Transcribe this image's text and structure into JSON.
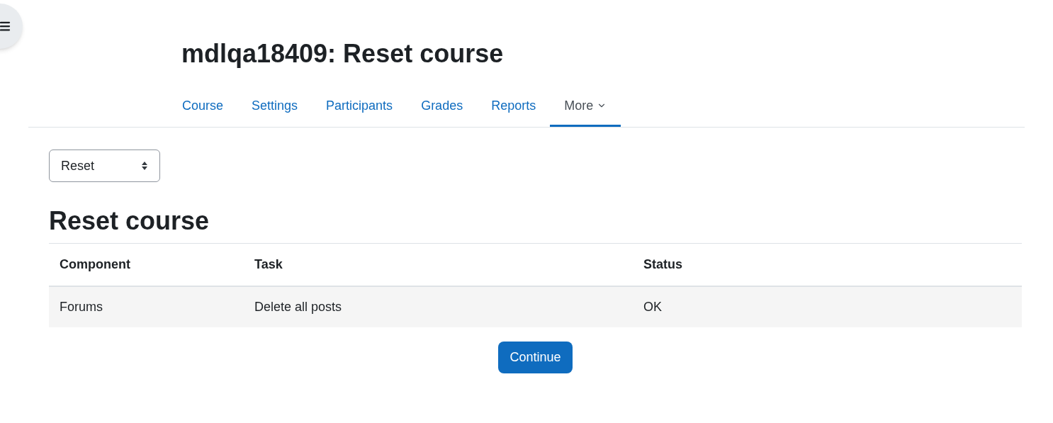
{
  "page_title": "mdlqa18409: Reset course",
  "tabs": [
    {
      "label": "Course",
      "selected": false,
      "kind": "link"
    },
    {
      "label": "Settings",
      "selected": false,
      "kind": "link"
    },
    {
      "label": "Participants",
      "selected": false,
      "kind": "link"
    },
    {
      "label": "Grades",
      "selected": false,
      "kind": "link"
    },
    {
      "label": "Reports",
      "selected": false,
      "kind": "link"
    },
    {
      "label": "More",
      "selected": true,
      "kind": "dropdown"
    }
  ],
  "select": {
    "value": "Reset"
  },
  "heading": "Reset course",
  "table": {
    "columns": [
      "Component",
      "Task",
      "Status"
    ],
    "rows": [
      [
        "Forums",
        "Delete all posts",
        "OK"
      ]
    ]
  },
  "button": "Continue"
}
